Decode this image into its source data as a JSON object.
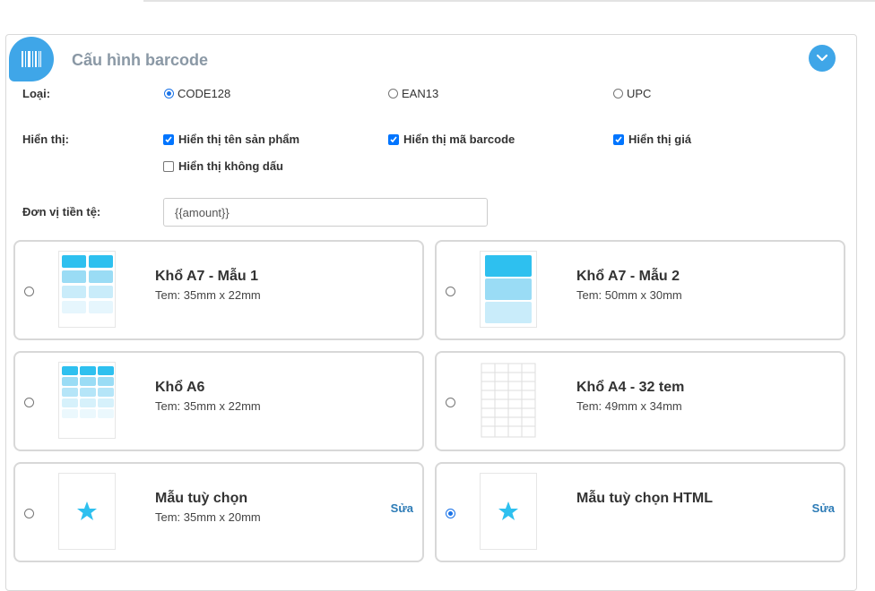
{
  "header": {
    "title": "Cấu hình barcode",
    "icon": "barcode-icon",
    "collapse_icon": "chevron-down-icon"
  },
  "type": {
    "label": "Loại:",
    "options": [
      {
        "label": "CODE128",
        "selected": true
      },
      {
        "label": "EAN13",
        "selected": false
      },
      {
        "label": "UPC",
        "selected": false
      }
    ]
  },
  "display": {
    "label": "Hiển thị:",
    "options": [
      {
        "label": "Hiển thị tên sản phẩm",
        "checked": true
      },
      {
        "label": "Hiển thị mã barcode",
        "checked": true
      },
      {
        "label": "Hiển thị giá",
        "checked": true
      },
      {
        "label": "Hiển thị không dấu",
        "checked": false
      }
    ]
  },
  "currency": {
    "label": "Đơn vị tiền tệ:",
    "value": "{{amount}}"
  },
  "templates": [
    {
      "title": "Khổ A7 - Mẫu 1",
      "size": "Tem: 35mm x 22mm",
      "selected": false
    },
    {
      "title": "Khổ A7 - Mẫu 2",
      "size": "Tem: 50mm x 30mm",
      "selected": false
    },
    {
      "title": "Khổ A6",
      "size": "Tem: 35mm x 22mm",
      "selected": false
    },
    {
      "title": "Khổ A4 - 32 tem",
      "size": "Tem: 49mm x 34mm",
      "selected": false
    },
    {
      "title": "Mẫu tuỳ chọn",
      "size": "Tem: 35mm x 20mm",
      "selected": false,
      "edit": "Sửa"
    },
    {
      "title": "Mẫu tuỳ chọn HTML",
      "size": "",
      "selected": true,
      "edit": "Sửa"
    }
  ],
  "colors": {
    "accent": "#3fa6e8",
    "cell_dark": "#2ec0ef",
    "cell_mid": "#9adcf5",
    "cell_light": "#c9ecfa",
    "cell_faint": "#e6f6fd",
    "star": "#2ec0ef"
  }
}
